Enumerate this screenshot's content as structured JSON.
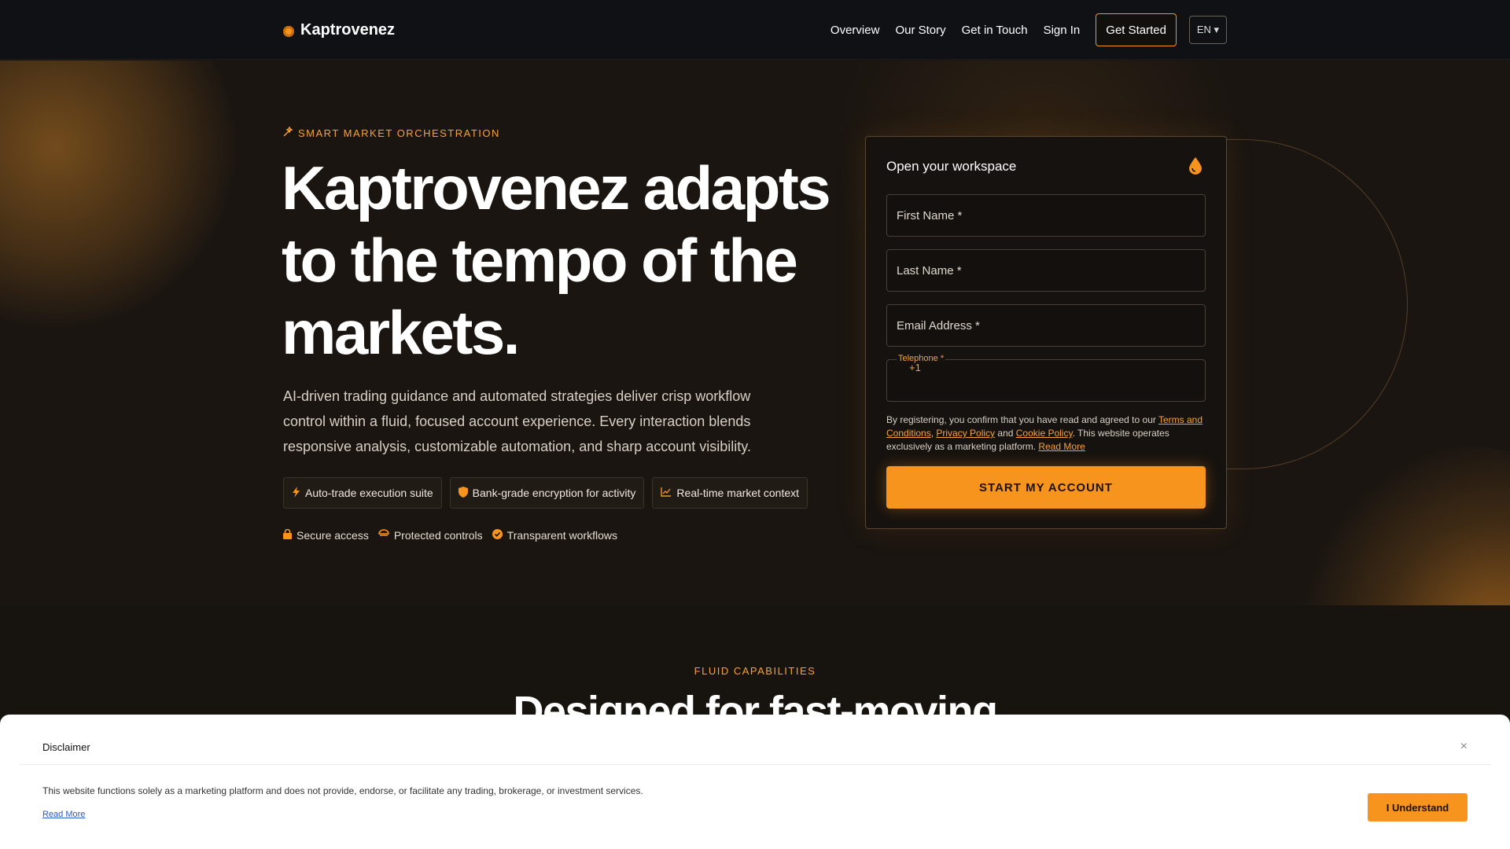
{
  "nav": {
    "brand": "Kaptrovenez",
    "links": [
      "Overview",
      "Our Story",
      "Get in Touch",
      "Sign In"
    ],
    "cta": "Get Started",
    "lang": "EN ▾"
  },
  "hero": {
    "eyebrow": "SMART MARKET ORCHESTRATION",
    "headline": "Kaptrovenez adapts to the tempo of the markets.",
    "subtext": "AI-driven trading guidance and automated strategies deliver crisp workflow control within a fluid, focused account experience. Every interaction blends responsive analysis, customizable automation, and sharp account visibility.",
    "chips": [
      {
        "icon": "bolt-icon",
        "label": "Auto-trade execution suite"
      },
      {
        "icon": "shield-icon",
        "label": "Bank-grade encryption for activity"
      },
      {
        "icon": "chart-line-icon",
        "label": "Real-time market context"
      }
    ],
    "trust": [
      {
        "icon": "lock-icon",
        "label": "Secure access"
      },
      {
        "icon": "badge-icon",
        "label": "Protected controls"
      },
      {
        "icon": "check-circle-icon",
        "label": "Transparent workflows"
      }
    ]
  },
  "form": {
    "title": "Open your workspace",
    "fields": {
      "first_name": "First Name *",
      "last_name": "Last Name *",
      "email": "Email Address *",
      "telephone_label": "Telephone *",
      "telephone_prefix": "+1"
    },
    "legal": {
      "prefix": "By registering, you confirm that you have read and agreed to our ",
      "terms": "Terms and Conditions",
      "sep1": ", ",
      "privacy": "Privacy Policy",
      "sep2": " and ",
      "cookie": "Cookie Policy",
      "suffix": ". This website operates exclusively as a marketing platform. ",
      "read_more": "Read More"
    },
    "submit": "START MY ACCOUNT"
  },
  "section": {
    "eyebrow": "FLUID CAPABILITIES",
    "title": "Designed for fast-moving"
  },
  "disclaimer": {
    "title": "Disclaimer",
    "text": "This website functions solely as a marketing platform and does not provide, endorse, or facilitate any trading, brokerage, or investment services.",
    "read_more": "Read More",
    "button": "I Understand",
    "close": "×"
  },
  "colors": {
    "accent": "#f7941d",
    "background": "#1a1511",
    "nav_bg": "#0f1115"
  }
}
